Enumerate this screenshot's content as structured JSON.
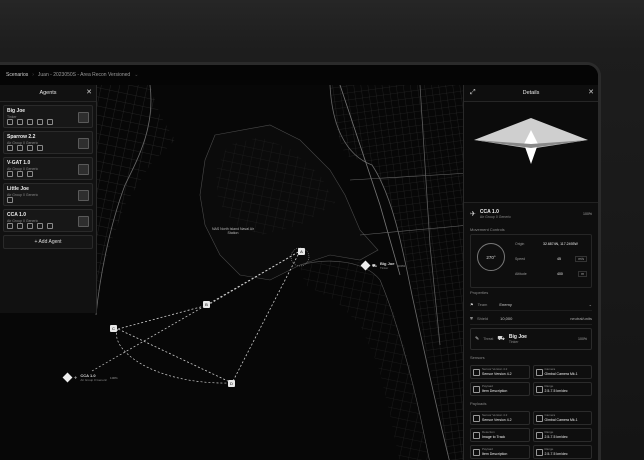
{
  "topbar": {
    "crumbs": [
      "Scenarios",
      "Juan - 2023050S - Area Recon Versioned"
    ]
  },
  "agents": {
    "title": "Agents",
    "items": [
      {
        "name": "Big Joe",
        "sub": "Tinker",
        "pct": ""
      },
      {
        "name": "Sparrow 2.2",
        "sub": "Air Group 0 Generic",
        "pct": ""
      },
      {
        "name": "V-GAT 1.0",
        "sub": "Air Group 0 Generic",
        "pct": ""
      },
      {
        "name": "Little Joe",
        "sub": "Air Group 0 Generic",
        "pct": ""
      },
      {
        "name": "CCA 1.0",
        "sub": "Air Group 0 Generic",
        "pct": ""
      }
    ],
    "add_label": "+ Add Agent"
  },
  "map": {
    "island_label": "NAS North Island Naval Air Station",
    "unit_label": "CCA 1.0",
    "unit_sub": "Air Group 0 Generic",
    "unit_pct": "100%",
    "target_label": "Big Joe",
    "target_sub": "Tinker",
    "target_pct": "100%",
    "waypoints": [
      "A",
      "B",
      "C",
      "D"
    ]
  },
  "details": {
    "title": "Details",
    "asset_name": "CCA 1.0",
    "asset_sub": "Air Group 0 Generic",
    "asset_pct": "100%",
    "movement_title": "Movement Controls",
    "heading": "270°",
    "origin_label": "Origin",
    "origin_val": "32.6874N, 117.2493W",
    "speed_label": "Speed",
    "speed_val": "45",
    "speed_unit": "m/s",
    "altitude_label": "Altitude",
    "altitude_val": "400",
    "altitude_unit": "m",
    "properties_title": "Properties",
    "team_label": "Team",
    "team_val": "Enemy",
    "shield_label": "Shield",
    "shield_val": "10,000",
    "shield_unit": "neutral/units",
    "threat_label": "Threat",
    "target_name": "Big Joe",
    "target_sub": "Tinker",
    "target_pct": "100%",
    "sensors_title": "Sensors",
    "sensors": [
      {
        "t": "Sensor Version 4.2",
        "v": "Sensor Version 4.2"
      },
      {
        "t": "Camera",
        "v": "Gimbal Camera Mk.1"
      },
      {
        "t": "Payload",
        "v": "Item Description"
      },
      {
        "t": "Range",
        "v": "2.5-7.5 km/dec"
      }
    ],
    "payloads_title": "Payloads",
    "payloads": [
      {
        "t": "Sensor Version 4.2",
        "v": "Sensor Version 4.2"
      },
      {
        "t": "Camera",
        "v": "Gimbal Camera Mk.1"
      },
      {
        "t": "Detection",
        "v": "Image to Track"
      },
      {
        "t": "Range",
        "v": "2.5-7.5 km/dec"
      },
      {
        "t": "Payload",
        "v": "Item Description"
      },
      {
        "t": "Range",
        "v": "2.5-7.5 km/dec"
      }
    ]
  }
}
